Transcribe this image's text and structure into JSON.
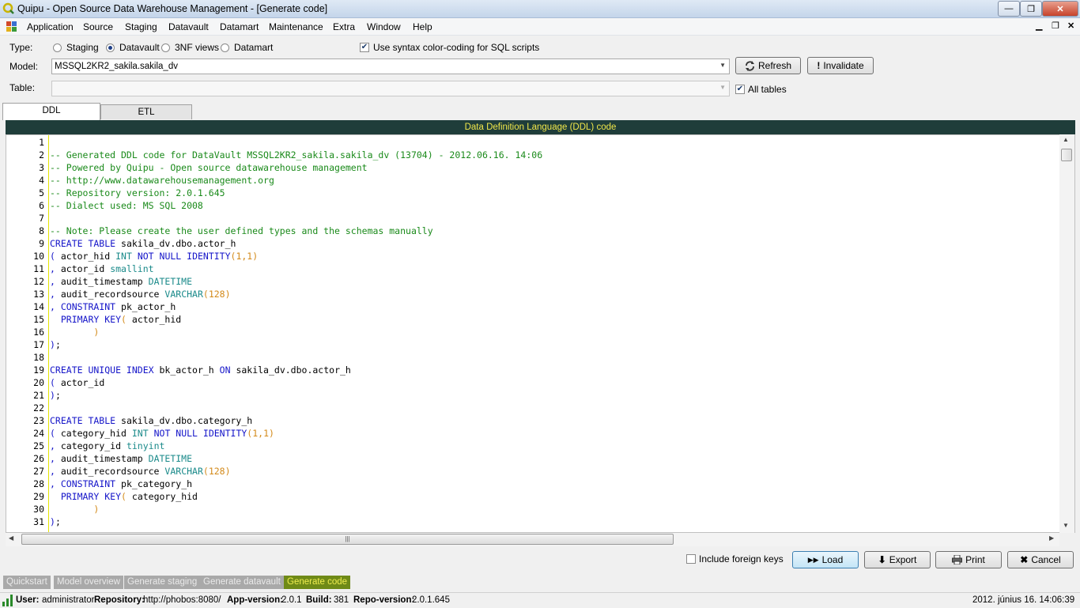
{
  "window": {
    "title": "Quipu - Open Source Data Warehouse Management  - [Generate code]",
    "controls": {
      "minimize": "—",
      "maximize": "❐",
      "close": "✕"
    }
  },
  "menu": [
    "Application",
    "Source",
    "Staging",
    "Datavault",
    "Datamart",
    "Maintenance",
    "Extra",
    "Window",
    "Help"
  ],
  "mdi_controls": {
    "minimize": "▁",
    "restore": "❐",
    "close": "✕"
  },
  "form": {
    "type_label": "Type:",
    "type_options": [
      "Staging",
      "Datavault",
      "3NF views",
      "Datamart"
    ],
    "type_selected": "Datavault",
    "syntax_color_label": "Use syntax color-coding for SQL scripts",
    "model_label": "Model:",
    "model_value": "MSSQL2KR2_sakila.sakila_dv",
    "refresh_label": "Refresh",
    "invalidate_label": "Invalidate",
    "table_label": "Table:",
    "table_value": "",
    "all_tables_label": "All tables"
  },
  "tabs": [
    "DDL",
    "ETL"
  ],
  "code_header": "Data Definition Language (DDL) code",
  "code": [
    {
      "n": "1",
      "t": [
        [
          "",
          ""
        ]
      ]
    },
    {
      "n": "2",
      "t": [
        [
          "cm",
          "-- Generated DDL code for DataVault MSSQL2KR2_sakila.sakila_dv (13704) - 2012.06.16. 14:06"
        ]
      ]
    },
    {
      "n": "3",
      "t": [
        [
          "cm",
          "-- Powered by Quipu - Open source datawarehouse management"
        ]
      ]
    },
    {
      "n": "4",
      "t": [
        [
          "cm",
          "-- http://www.datawarehousemanagement.org"
        ]
      ]
    },
    {
      "n": "5",
      "t": [
        [
          "cm",
          "-- Repository version: 2.0.1.645"
        ]
      ]
    },
    {
      "n": "6",
      "t": [
        [
          "cm",
          "-- Dialect used: MS SQL 2008"
        ]
      ]
    },
    {
      "n": "7",
      "t": [
        [
          "",
          ""
        ]
      ]
    },
    {
      "n": "8",
      "t": [
        [
          "cm",
          "-- Note: Please create the user defined types and the schemas manually"
        ]
      ]
    },
    {
      "n": "9",
      "t": [
        [
          "kw",
          "CREATE TABLE"
        ],
        [
          "",
          " sakila_dv.dbo.actor_h"
        ]
      ]
    },
    {
      "n": "10",
      "t": [
        [
          "kw",
          "("
        ],
        [
          "",
          " actor_hid "
        ],
        [
          "ty",
          "INT"
        ],
        [
          "",
          " "
        ],
        [
          "kw",
          "NOT NULL IDENTITY"
        ],
        [
          "num",
          "(1,1)"
        ]
      ]
    },
    {
      "n": "11",
      "t": [
        [
          "kw",
          ","
        ],
        [
          "",
          " actor_id "
        ],
        [
          "ty",
          "smallint"
        ]
      ]
    },
    {
      "n": "12",
      "t": [
        [
          "kw",
          ","
        ],
        [
          "",
          " audit_timestamp "
        ],
        [
          "ty",
          "DATETIME"
        ]
      ]
    },
    {
      "n": "13",
      "t": [
        [
          "kw",
          ","
        ],
        [
          "",
          " audit_recordsource "
        ],
        [
          "ty",
          "VARCHAR"
        ],
        [
          "num",
          "(128)"
        ]
      ]
    },
    {
      "n": "14",
      "t": [
        [
          "kw",
          ","
        ],
        [
          "",
          " "
        ],
        [
          "kw",
          "CONSTRAINT"
        ],
        [
          "",
          " pk_actor_h"
        ]
      ]
    },
    {
      "n": "15",
      "t": [
        [
          "",
          "  "
        ],
        [
          "kw",
          "PRIMARY KEY"
        ],
        [
          "num",
          "("
        ],
        [
          "",
          " actor_hid"
        ]
      ]
    },
    {
      "n": "16",
      "t": [
        [
          "",
          "        "
        ],
        [
          "num",
          ")"
        ]
      ]
    },
    {
      "n": "17",
      "t": [
        [
          "kw",
          ")"
        ],
        [
          "",
          ";"
        ]
      ]
    },
    {
      "n": "18",
      "t": [
        [
          "",
          ""
        ]
      ]
    },
    {
      "n": "19",
      "t": [
        [
          "kw",
          "CREATE UNIQUE INDEX"
        ],
        [
          "",
          " bk_actor_h "
        ],
        [
          "kw",
          "ON"
        ],
        [
          "",
          " sakila_dv.dbo.actor_h"
        ]
      ]
    },
    {
      "n": "20",
      "t": [
        [
          "kw",
          "("
        ],
        [
          "",
          " actor_id"
        ]
      ]
    },
    {
      "n": "21",
      "t": [
        [
          "kw",
          ")"
        ],
        [
          "",
          ";"
        ]
      ]
    },
    {
      "n": "22",
      "t": [
        [
          "",
          ""
        ]
      ]
    },
    {
      "n": "23",
      "t": [
        [
          "kw",
          "CREATE TABLE"
        ],
        [
          "",
          " sakila_dv.dbo.category_h"
        ]
      ]
    },
    {
      "n": "24",
      "t": [
        [
          "kw",
          "("
        ],
        [
          "",
          " category_hid "
        ],
        [
          "ty",
          "INT"
        ],
        [
          "",
          " "
        ],
        [
          "kw",
          "NOT NULL IDENTITY"
        ],
        [
          "num",
          "(1,1)"
        ]
      ]
    },
    {
      "n": "25",
      "t": [
        [
          "kw",
          ","
        ],
        [
          "",
          " category_id "
        ],
        [
          "ty",
          "tinyint"
        ]
      ]
    },
    {
      "n": "26",
      "t": [
        [
          "kw",
          ","
        ],
        [
          "",
          " audit_timestamp "
        ],
        [
          "ty",
          "DATETIME"
        ]
      ]
    },
    {
      "n": "27",
      "t": [
        [
          "kw",
          ","
        ],
        [
          "",
          " audit_recordsource "
        ],
        [
          "ty",
          "VARCHAR"
        ],
        [
          "num",
          "(128)"
        ]
      ]
    },
    {
      "n": "28",
      "t": [
        [
          "kw",
          ","
        ],
        [
          "",
          " "
        ],
        [
          "kw",
          "CONSTRAINT"
        ],
        [
          "",
          " pk_category_h"
        ]
      ]
    },
    {
      "n": "29",
      "t": [
        [
          "",
          "  "
        ],
        [
          "kw",
          "PRIMARY KEY"
        ],
        [
          "num",
          "("
        ],
        [
          "",
          " category_hid"
        ]
      ]
    },
    {
      "n": "30",
      "t": [
        [
          "",
          "        "
        ],
        [
          "num",
          ")"
        ]
      ]
    },
    {
      "n": "31",
      "t": [
        [
          "kw",
          ")"
        ],
        [
          "",
          ";"
        ]
      ]
    }
  ],
  "bottom": {
    "include_fk_label": "Include foreign keys",
    "load_label": "Load",
    "export_label": "Export",
    "print_label": "Print",
    "cancel_label": "Cancel"
  },
  "nav_tabs": [
    "Quickstart",
    "Model overview",
    "Generate staging",
    "Generate datavault",
    "Generate code"
  ],
  "nav_active": "Generate code",
  "status": {
    "user_label": "User:",
    "user": "administrator",
    "repo_label": "Repository:",
    "repo": "http://phobos:8080/",
    "appver_label": "App-version:",
    "appver": "2.0.1",
    "build_label": "Build:",
    "build": "381",
    "repover_label": "Repo-version:",
    "repover": "2.0.1.645",
    "datetime": "2012. június 16. 14:06:39"
  },
  "colors": {
    "comment": "#1a8a1a",
    "keyword": "#1515c9",
    "type": "#1a8a8a",
    "number": "#d38a1a",
    "header_bg": "#1f3d3a",
    "header_fg": "#f0e64a",
    "active_tab": "#6f8a17"
  }
}
